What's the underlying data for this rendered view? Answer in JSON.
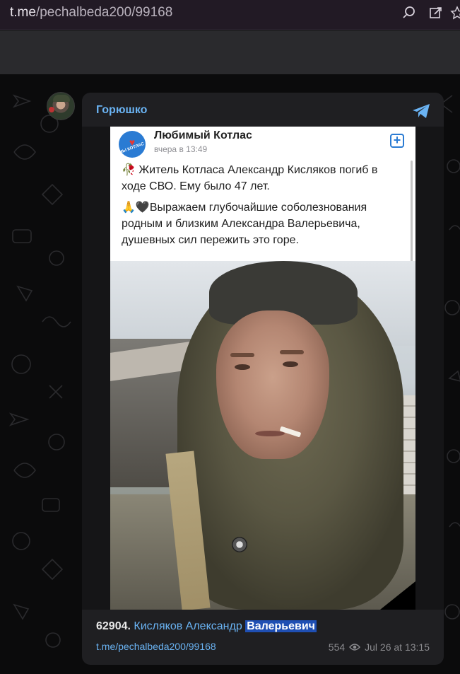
{
  "browser": {
    "url_host": "t.me",
    "url_path": "/pechalbeda200/99168",
    "icons": [
      "search-zoom-icon",
      "edit-share-icon",
      "star-icon"
    ]
  },
  "post": {
    "author": "Горюшко",
    "share_icon": "telegram-plane-icon",
    "photo": {
      "vk_group": "Любимый Котлас",
      "vk_avatar_text": "МЫ КОТЛАС",
      "vk_time": "вчера в 13:49",
      "vk_text_1": "🥀 Житель Котласа Александр Кисляков погиб в ходе СВО. Ему было 47 лет.",
      "vk_text_2": "🙏🖤Выражаем глубочайшие соболезнования родным и близким Александра Валерьевича, душевных сил пережить это горе."
    },
    "caption_number": "62904.",
    "caption_name": "Кисляков Александр",
    "caption_highlight": "Валерьевич",
    "link": "t.me/pechalbeda200/99168",
    "views": "554",
    "date": "Jul 26 at 13:15"
  }
}
